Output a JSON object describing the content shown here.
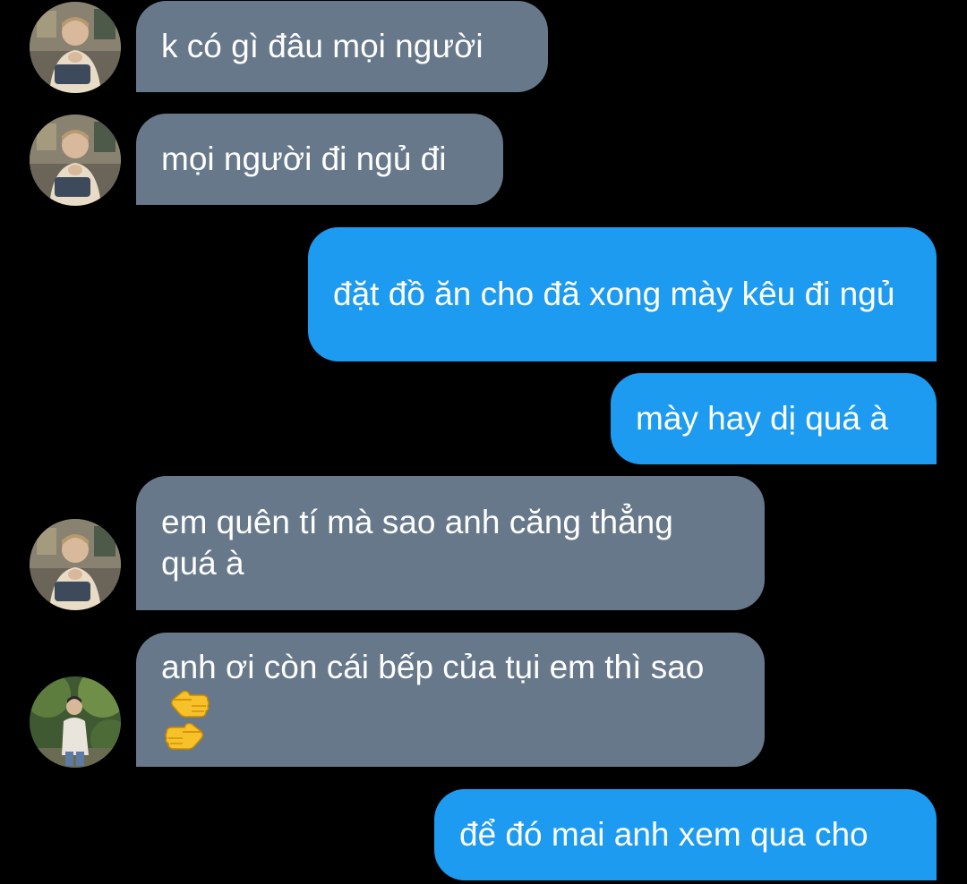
{
  "conversation": {
    "messages": [
      {
        "direction": "incoming",
        "sender": "user-a",
        "text": "k có gì đâu mọi người"
      },
      {
        "direction": "incoming",
        "sender": "user-a",
        "text": "mọi người đi ngủ đi"
      },
      {
        "direction": "outgoing",
        "text": "đặt đồ ăn cho đã xong mày kêu đi ngủ"
      },
      {
        "direction": "outgoing",
        "text": "mày hay dị quá à"
      },
      {
        "direction": "incoming",
        "sender": "user-a",
        "text": "em quên tí mà sao anh căng thẳng quá à"
      },
      {
        "direction": "incoming",
        "sender": "user-b",
        "text": "anh ơi còn cái bếp của tụi em thì sao",
        "emoji": [
          "backhand-index-pointing-left",
          "backhand-index-pointing-right"
        ]
      },
      {
        "direction": "outgoing",
        "text": "để đó mai anh xem qua cho"
      }
    ]
  },
  "colors": {
    "background": "#000000",
    "incoming_bubble": "#66788a",
    "outgoing_bubble": "#1d9bf0",
    "text": "#ffffff"
  }
}
